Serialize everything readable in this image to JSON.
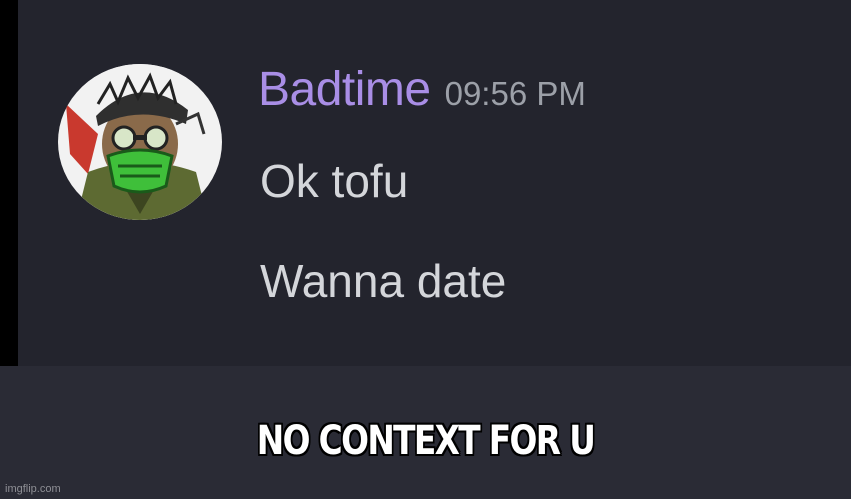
{
  "message": {
    "username": "Badtime",
    "timestamp": "09:56 PM",
    "lines": [
      "Ok tofu",
      "Wanna date"
    ],
    "avatar": "character-avatar-icon"
  },
  "caption": "NO CONTEXT FOR U",
  "watermark": "imgflip.com",
  "colors": {
    "background": "#2a2b35",
    "chat_background": "#23242d",
    "username": "#a98ee6",
    "timestamp": "#9ca0a8",
    "message_text": "#d4d6da",
    "caption": "#ffffff"
  }
}
